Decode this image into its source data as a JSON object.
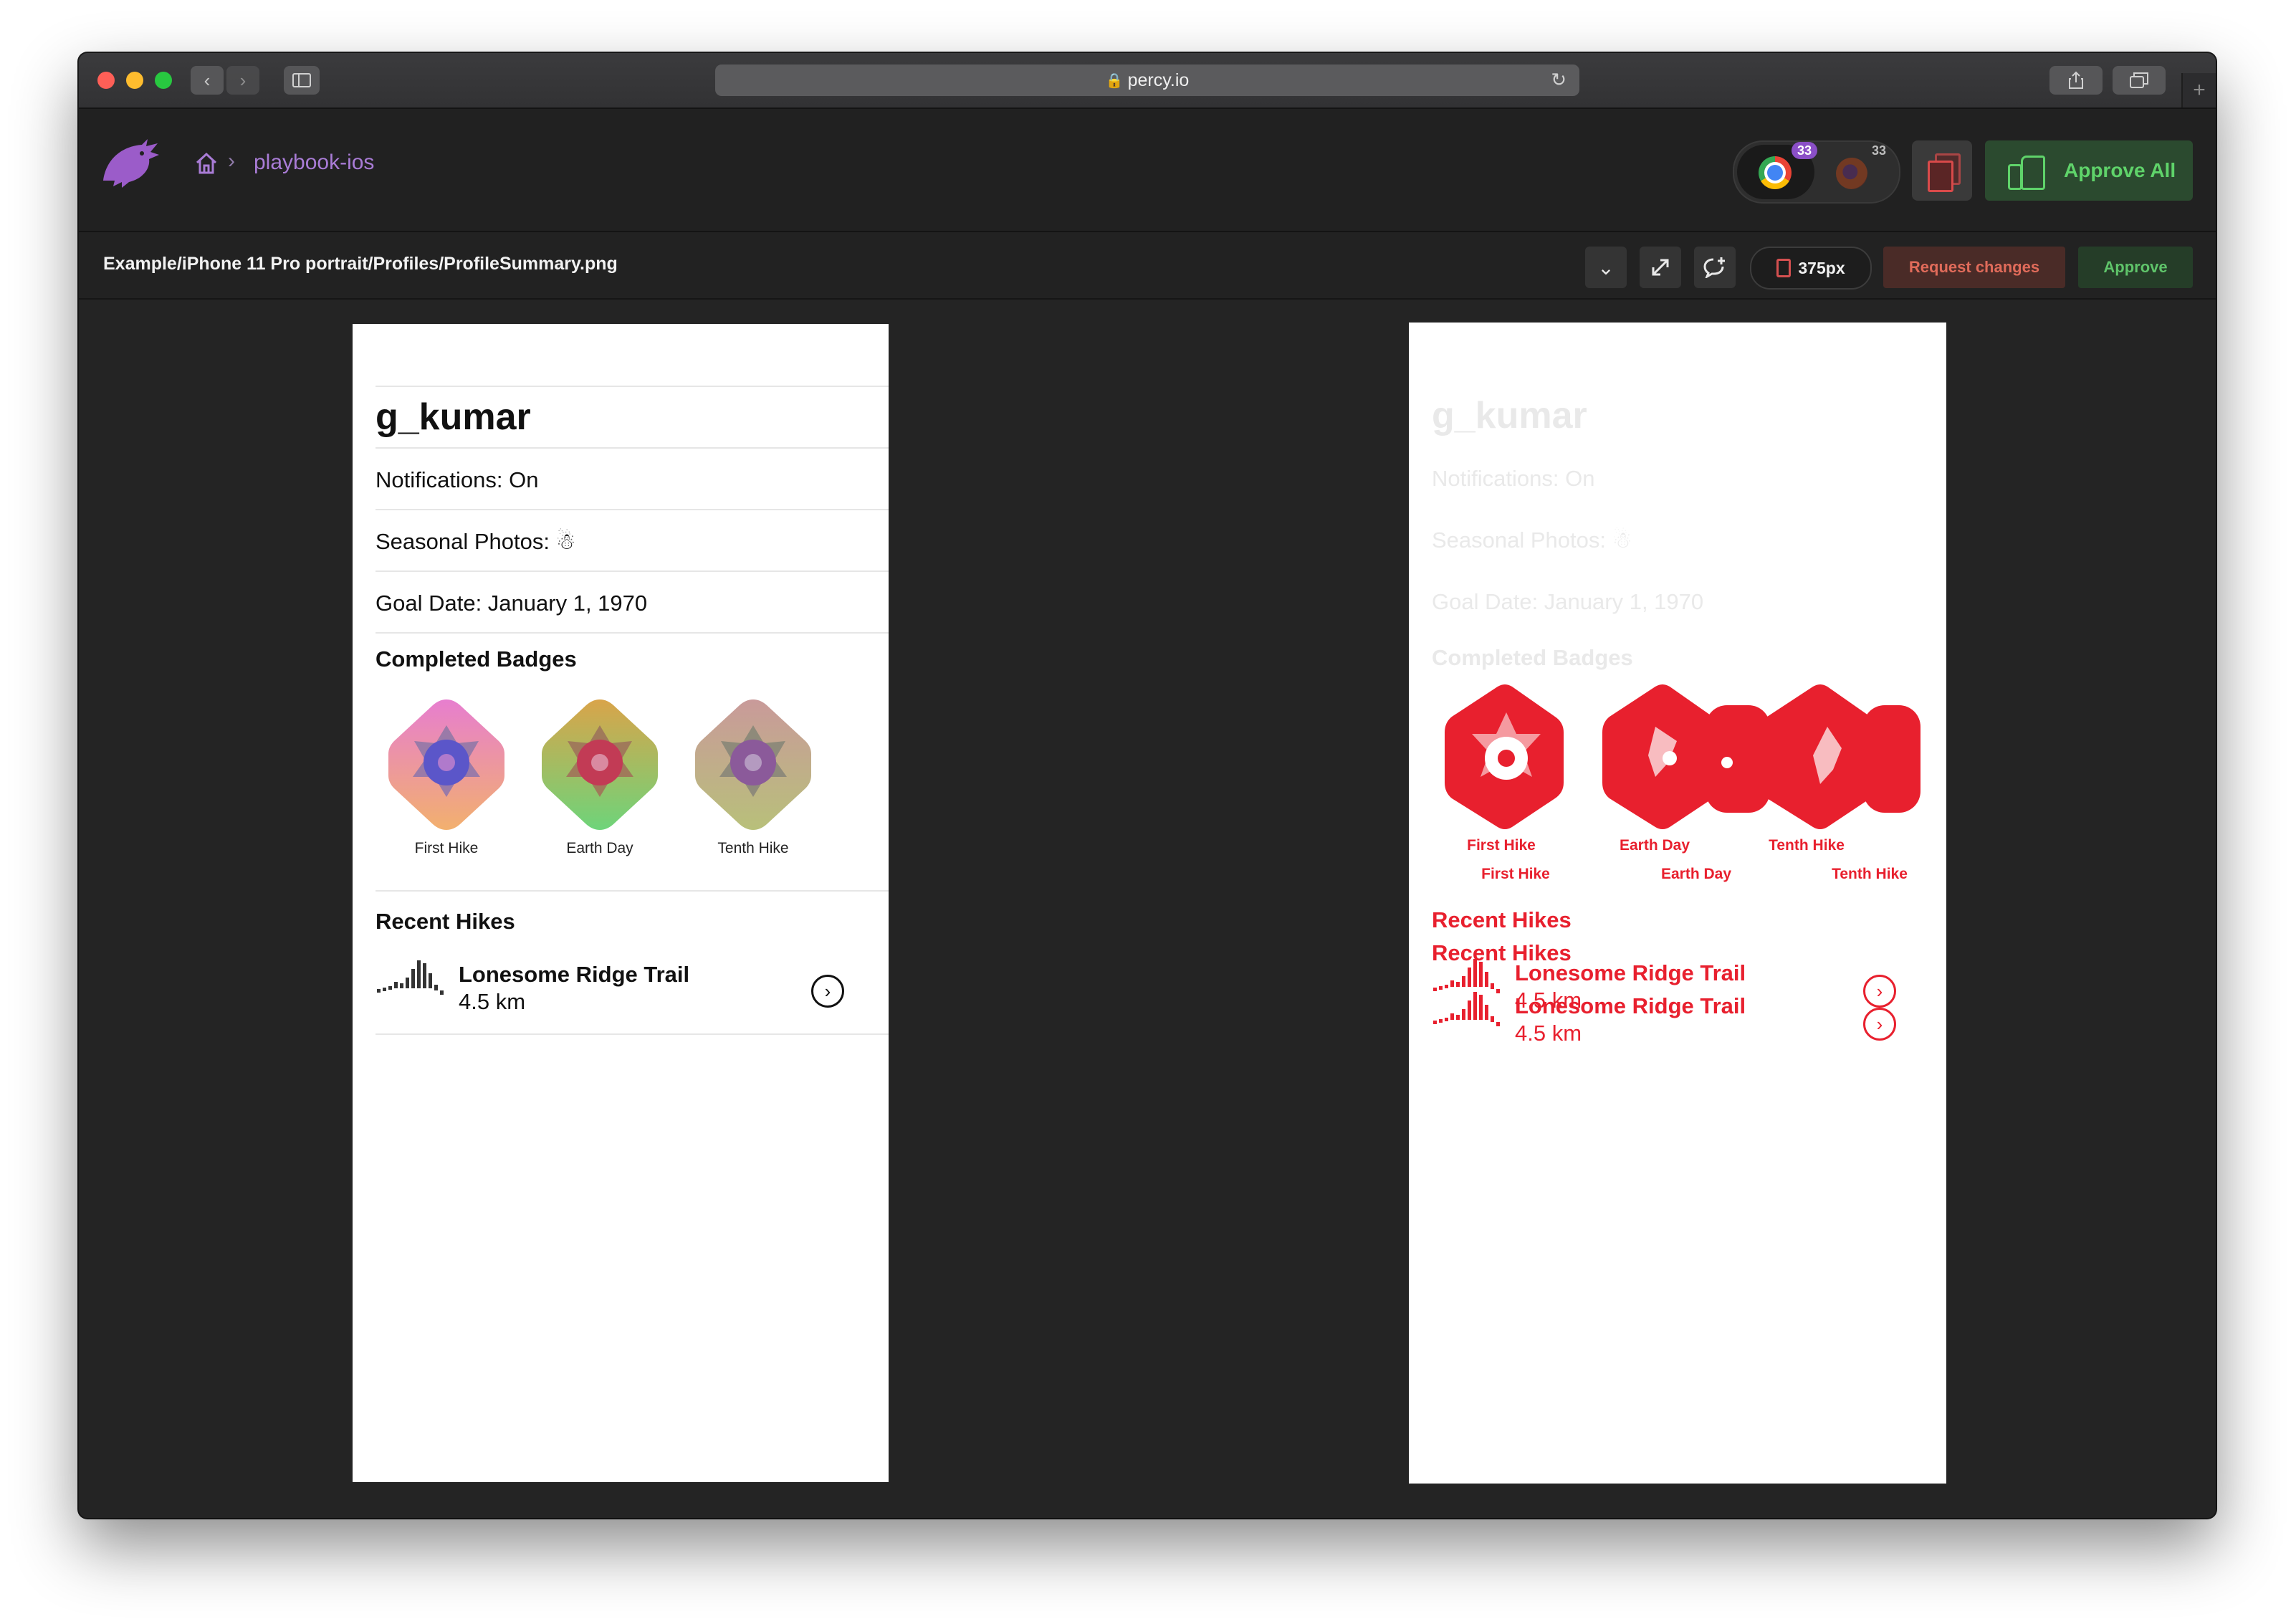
{
  "browser": {
    "url": "percy.io"
  },
  "header": {
    "project": "playbook-ios",
    "chrome_count": "33",
    "firefox_count": "33",
    "approve_all_label": "Approve All"
  },
  "snapshot": {
    "name": "Example/iPhone 11 Pro portrait/Profiles/ProfileSummary.png",
    "width_label": "375px",
    "request_changes_label": "Request changes",
    "approve_label": "Approve"
  },
  "profile": {
    "username": "g_kumar",
    "notifications": "Notifications: On",
    "seasonal_photos": "Seasonal Photos:",
    "seasonal_emoji": "☃",
    "goal_date": "Goal Date: January 1, 1970",
    "completed_badges_heading": "Completed Badges",
    "badges": [
      "First Hike",
      "Earth Day",
      "Tenth Hike"
    ],
    "recent_hikes_heading": "Recent Hikes",
    "hike_name": "Lonesome Ridge Trail",
    "hike_distance": "4.5 km"
  },
  "colors": {
    "percy_purple": "#a97cd6",
    "diff_red": "#e8202e",
    "approve_green": "#5fd36a",
    "request_red": "#e06b5a"
  }
}
